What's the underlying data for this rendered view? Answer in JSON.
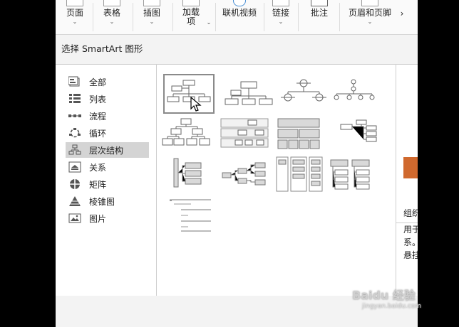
{
  "ribbon": {
    "items": [
      {
        "label": "页面",
        "has_dropdown": true
      },
      {
        "label": "表格",
        "has_dropdown": true
      },
      {
        "label": "插图",
        "has_dropdown": true
      },
      {
        "label": "加载\n项",
        "has_dropdown": true
      },
      {
        "label": "联机视频",
        "has_dropdown": false
      },
      {
        "label": "链接",
        "has_dropdown": true
      },
      {
        "label": "批注",
        "has_dropdown": false
      },
      {
        "label": "页眉和页脚",
        "has_dropdown": true
      }
    ],
    "scroll_arrow": "›",
    "dropdown_glyph": "⌄"
  },
  "dialog": {
    "title": "选择 SmartArt 图形",
    "categories": [
      {
        "label": "全部",
        "icon": "all-icon"
      },
      {
        "label": "列表",
        "icon": "list-icon"
      },
      {
        "label": "流程",
        "icon": "process-icon"
      },
      {
        "label": "循环",
        "icon": "cycle-icon"
      },
      {
        "label": "层次结构",
        "icon": "hierarchy-icon",
        "selected": true
      },
      {
        "label": "关系",
        "icon": "relationship-icon"
      },
      {
        "label": "矩阵",
        "icon": "matrix-icon"
      },
      {
        "label": "棱锥图",
        "icon": "pyramid-icon"
      },
      {
        "label": "图片",
        "icon": "picture-icon"
      }
    ],
    "layouts": [
      {
        "name": "organization-chart",
        "selected": true
      },
      {
        "name": "name-and-title-org-chart"
      },
      {
        "name": "circle-picture-hierarchy"
      },
      {
        "name": "hierarchy-dots"
      },
      {
        "name": "hierarchy"
      },
      {
        "name": "labeled-hierarchy"
      },
      {
        "name": "table-hierarchy"
      },
      {
        "name": "horizontal-org-chart"
      },
      {
        "name": "horizontal-multi-level-hierarchy"
      },
      {
        "name": "horizontal-hierarchy"
      },
      {
        "name": "lined-list"
      },
      {
        "name": "hierarchy-list"
      },
      {
        "name": "horizontal-labeled-hierarchy"
      }
    ],
    "description": {
      "title": "组织",
      "lines": [
        "用于",
        "系。",
        "悬挂"
      ]
    }
  },
  "watermark": {
    "text": "Baidu 经验",
    "sub": "jingyan.baidu.com"
  },
  "colors": {
    "accent": "#d0692e",
    "selected_bg": "#d4d4d4"
  }
}
